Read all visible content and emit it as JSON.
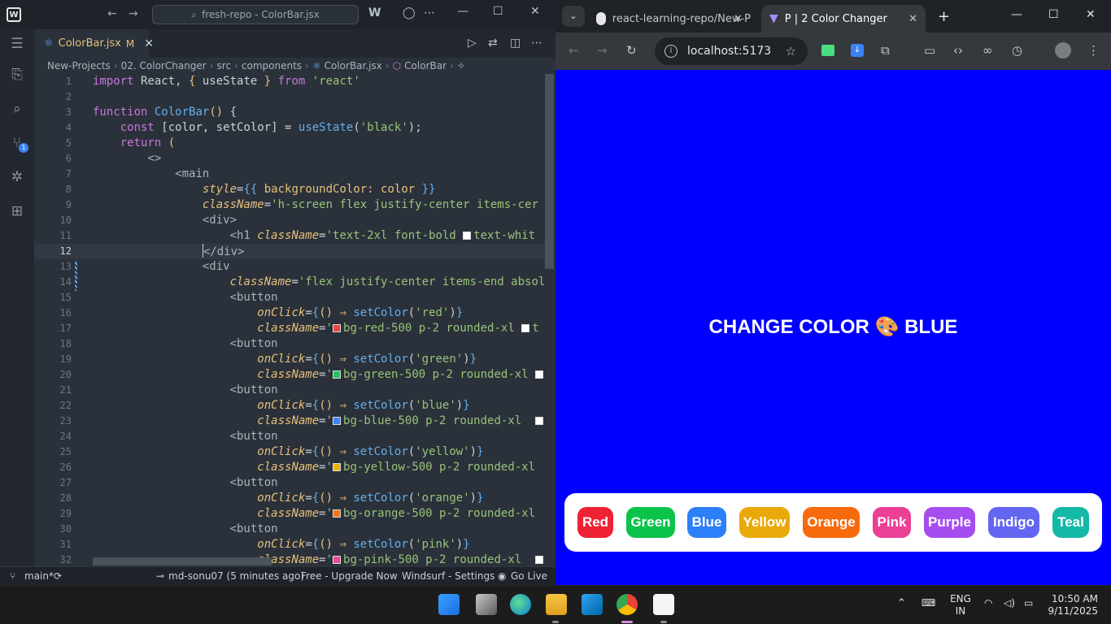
{
  "editor": {
    "window_title": "fresh-repo - ColorBar.jsx",
    "tab": {
      "file": "ColorBar.jsx",
      "modified": "M"
    },
    "breadcrumb": [
      "New-Projects",
      "02. ColorChanger",
      "src",
      "components",
      "ColorBar.jsx",
      "ColorBar"
    ],
    "scm_badge": "1",
    "lines": [
      {
        "n": "1"
      },
      {
        "n": "2"
      },
      {
        "n": "3"
      },
      {
        "n": "4"
      },
      {
        "n": "5"
      },
      {
        "n": "6"
      },
      {
        "n": "7"
      },
      {
        "n": "8"
      },
      {
        "n": "9"
      },
      {
        "n": "10"
      },
      {
        "n": "11"
      },
      {
        "n": "12"
      },
      {
        "n": "13"
      },
      {
        "n": "14"
      },
      {
        "n": "15"
      },
      {
        "n": "16"
      },
      {
        "n": "17"
      },
      {
        "n": "18"
      },
      {
        "n": "19"
      },
      {
        "n": "20"
      },
      {
        "n": "21"
      },
      {
        "n": "22"
      },
      {
        "n": "23"
      },
      {
        "n": "24"
      },
      {
        "n": "25"
      },
      {
        "n": "26"
      },
      {
        "n": "27"
      },
      {
        "n": "28"
      },
      {
        "n": "29"
      },
      {
        "n": "30"
      },
      {
        "n": "31"
      },
      {
        "n": "32"
      }
    ],
    "code": {
      "l1": [
        "import",
        " React, ",
        "{",
        " useState ",
        "}",
        " from ",
        "'react'"
      ],
      "l3": [
        "function",
        " ",
        "ColorBar",
        "()",
        " {"
      ],
      "l4": [
        "const",
        " [color, setColor] = ",
        "useState",
        "(",
        "'black'",
        ");"
      ],
      "l5": [
        "return",
        " ("
      ],
      "l6": "<>",
      "l7": [
        "<",
        "main"
      ],
      "l8": [
        "style",
        "=",
        "{{",
        " backgroundColor: color ",
        "}}"
      ],
      "l9": [
        "className",
        "=",
        "'h-screen flex justify-center items-cer"
      ],
      "l10": "<div>",
      "l11": [
        "<h1 ",
        "className",
        "=",
        "'text-2xl font-bold ",
        "text-whit"
      ],
      "l12": "</div>",
      "l13": "<div",
      "l14": [
        "className",
        "=",
        "'flex justify-center items-end absol"
      ],
      "button_tag": "<button",
      "onclick_attr": "onClick",
      "class_attr": "className",
      "arrow": "() ⇒ ",
      "set_color": "setColor",
      "buttons": [
        {
          "color": "'red'",
          "cls": "bg-red-500 p-2 rounded-xl",
          "tail": "t",
          "swatch": "#ef4444"
        },
        {
          "color": "'green'",
          "cls": "bg-green-500 p-2 rounded-xl",
          "tail": "",
          "swatch": "#22c55e"
        },
        {
          "color": "'blue'",
          "cls": "bg-blue-500 p-2 rounded-xl",
          "tail": "",
          "swatch": "#3b82f6"
        },
        {
          "color": "'yellow'",
          "cls": "bg-yellow-500 p-2 rounded-xl",
          "tail": "",
          "swatch": "#eab308"
        },
        {
          "color": "'orange'",
          "cls": "bg-orange-500 p-2 rounded-xl",
          "tail": "",
          "swatch": "#f97316"
        },
        {
          "color": "'pink'",
          "cls": "bg-pink-500 p-2 rounded-xl",
          "tail": "",
          "swatch": "#ec4899"
        }
      ]
    },
    "status": {
      "branch": "main*",
      "author": "md-sonu07 (5 minutes ago)",
      "upgrade": "Free - Upgrade Now",
      "settings": "Windsurf - Settings",
      "golive": "Go Live"
    }
  },
  "browser": {
    "tabs": [
      {
        "title": "react-learning-repo/New-P",
        "icon": "github-icon"
      },
      {
        "title": "P | 2 Color Changer",
        "icon": "vite-icon"
      }
    ],
    "url": "localhost:5173",
    "page": {
      "heading": "CHANGE COLOR 🎨 BLUE",
      "background": "#0000ff",
      "buttons": [
        {
          "label": "Red",
          "color": "#ef2233"
        },
        {
          "label": "Green",
          "color": "#0bc34a"
        },
        {
          "label": "Blue",
          "color": "#2d7ff9"
        },
        {
          "label": "Yellow",
          "color": "#e9a90a"
        },
        {
          "label": "Orange",
          "color": "#f86a0b"
        },
        {
          "label": "Pink",
          "color": "#ec3f96"
        },
        {
          "label": "Purple",
          "color": "#a64df0"
        },
        {
          "label": "Indigo",
          "color": "#6366f1"
        },
        {
          "label": "Teal",
          "color": "#14b8a6"
        }
      ]
    }
  },
  "taskbar": {
    "lang_top": "ENG",
    "lang_bottom": "IN",
    "time": "10:50 AM",
    "date": "9/11/2025"
  }
}
